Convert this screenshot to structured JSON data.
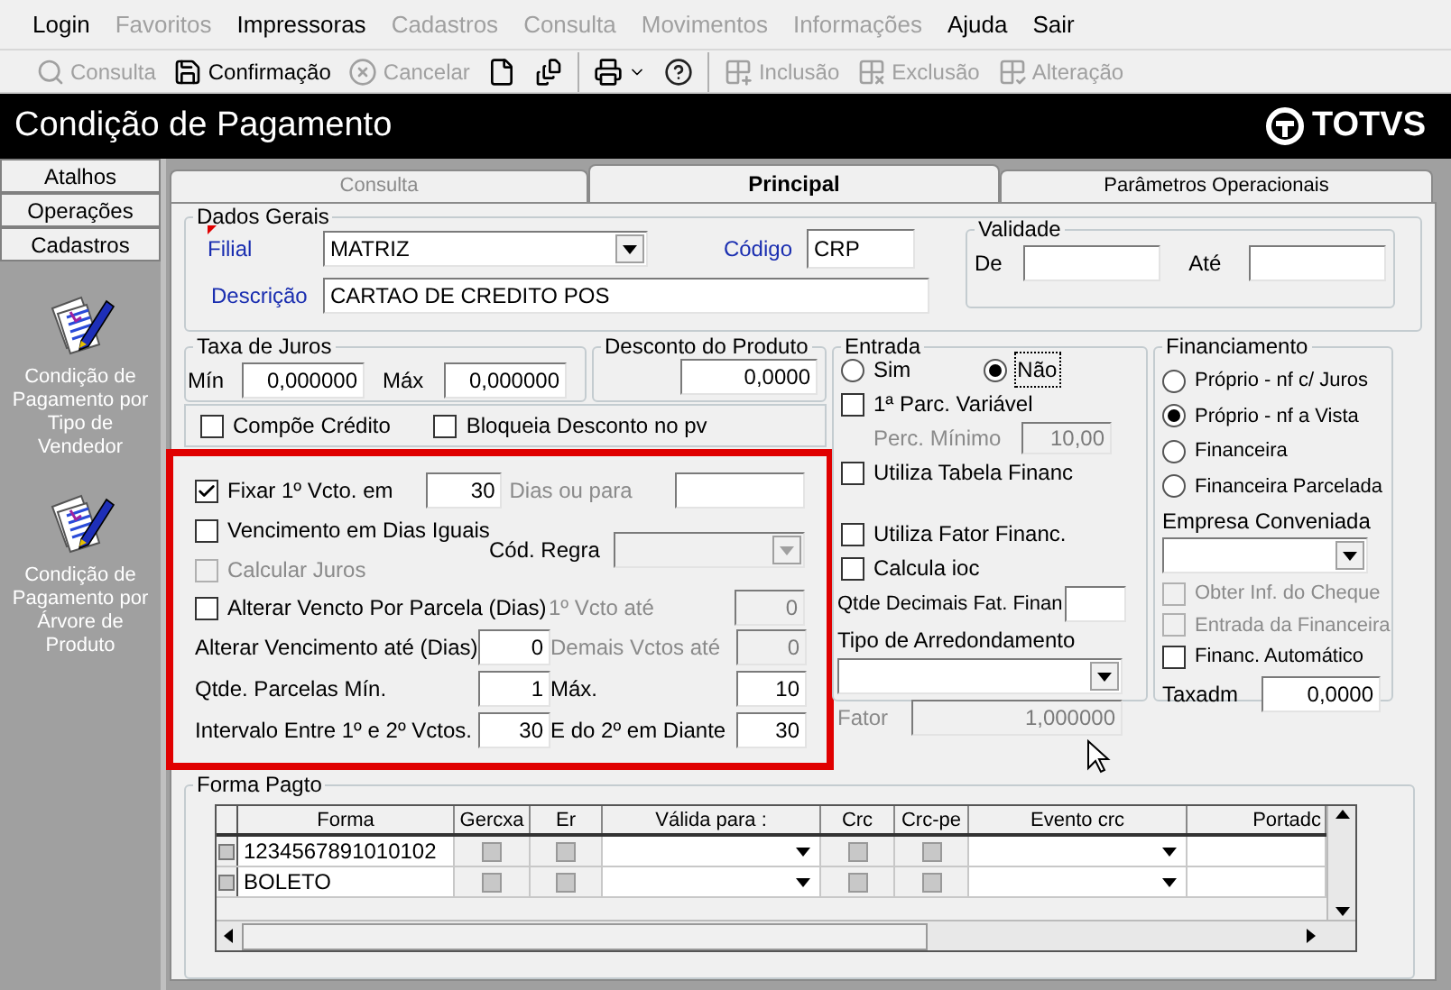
{
  "menu": [
    {
      "label": "Login",
      "disabled": false
    },
    {
      "label": "Favoritos",
      "disabled": true
    },
    {
      "label": "Impressoras",
      "disabled": false
    },
    {
      "label": "Cadastros",
      "disabled": true
    },
    {
      "label": "Consulta",
      "disabled": true
    },
    {
      "label": "Movimentos",
      "disabled": true
    },
    {
      "label": "Informações",
      "disabled": true
    },
    {
      "label": "Ajuda",
      "disabled": false
    },
    {
      "label": "Sair",
      "disabled": false
    }
  ],
  "toolbar": [
    {
      "items": [
        {
          "kind": "consult",
          "label": "Consulta",
          "disabled": true
        },
        {
          "kind": "save",
          "label": "Confirmação",
          "disabled": false
        },
        {
          "kind": "cancel",
          "label": "Cancelar",
          "disabled": true
        },
        {
          "kind": "new",
          "disabled": false
        },
        {
          "kind": "files",
          "disabled": false
        }
      ]
    },
    {
      "items": [
        {
          "kind": "print",
          "disabled": false,
          "dropdown": true
        },
        {
          "kind": "help",
          "disabled": false
        }
      ]
    },
    {
      "items": [
        {
          "kind": "add",
          "label": "Inclusão",
          "disabled": true
        },
        {
          "kind": "remove",
          "label": "Exclusão",
          "disabled": true
        },
        {
          "kind": "edit",
          "label": "Alteração",
          "disabled": true
        }
      ]
    }
  ],
  "header": {
    "title": "Condição de Pagamento",
    "logo": "TOTVS"
  },
  "sidebar": {
    "sections": [
      {
        "label": "Atalhos"
      },
      {
        "label": "Operações"
      },
      {
        "label": "Cadastros"
      }
    ],
    "items": [
      {
        "label": "Condição de Pagamento por Tipo de Vendedor"
      },
      {
        "label": "Condição de Pagamento por Árvore de Produto"
      }
    ]
  },
  "tabs": [
    {
      "label": "Consulta",
      "selected": false,
      "disabled": true
    },
    {
      "label": "Principal",
      "selected": true,
      "disabled": false
    },
    {
      "label": "Parâmetros Operacionais",
      "selected": false,
      "disabled": false
    }
  ],
  "dados_gerais": {
    "title": "Dados Gerais",
    "filial": {
      "label": "Filial",
      "required": true,
      "value": "MATRIZ"
    },
    "codigo": {
      "label": "Código",
      "value": "CRP"
    },
    "descricao": {
      "label": "Descrição",
      "value": "CARTAO DE CREDITO POS"
    },
    "validade": {
      "title": "Validade",
      "de": "De",
      "ate": "Até"
    }
  },
  "taxa_juros": {
    "title": "Taxa de Juros",
    "min_label": "Mín",
    "min": "0,000000",
    "max_label": "Máx",
    "max": "0,000000"
  },
  "desconto": {
    "title": "Desconto do Produto",
    "value": "0,0000"
  },
  "opcoes": [
    {
      "label": "Compõe Crédito",
      "checked": false
    },
    {
      "label": "Bloqueia Desconto no pv",
      "checked": false
    }
  ],
  "vencimento": {
    "highlighted": true,
    "checks": [
      {
        "label": "Fixar 1º Vcto. em",
        "checked": true,
        "disabled": false
      },
      {
        "label": "Vencimento em Dias Iguais",
        "checked": false,
        "disabled": false
      },
      {
        "label": "Calcular Juros",
        "checked": false,
        "disabled": true
      },
      {
        "label": "Alterar Vencto Por Parcela (Dias)",
        "checked": false,
        "disabled": false
      }
    ],
    "fixar_dias": "30",
    "dias_ou_para": {
      "label": "Dias ou para",
      "disabled": true
    },
    "cod_regra": {
      "label": "Cód. Regra",
      "disabled": true
    },
    "primeiro_vcto": {
      "label": "1º Vcto até",
      "value": "0",
      "disabled": true
    },
    "alterar": {
      "label": "Alterar Vencimento até (Dias)",
      "value": "0",
      "disabled": false
    },
    "demais": {
      "label": "Demais Vctos até",
      "value": "0",
      "disabled": true
    },
    "parcelas_min": {
      "label": "Qtde. Parcelas Mín.",
      "value": "1",
      "disabled": false
    },
    "parcelas_max": {
      "label": "Máx.",
      "value": "10",
      "disabled": false
    },
    "intervalo": {
      "label": "Intervalo Entre 1º e 2º Vctos.",
      "value": "30",
      "disabled": false
    },
    "diante": {
      "label": "E do 2º em Diante",
      "value": "30",
      "disabled": false
    }
  },
  "entrada": {
    "title": "Entrada",
    "radios": [
      {
        "label": "Sim",
        "selected": false
      },
      {
        "label": "Não",
        "selected": true
      }
    ],
    "parc_variavel": {
      "label": "1ª Parc. Variável",
      "checked": false
    },
    "perc_minimo": {
      "label": "Perc. Mínimo",
      "value": "10,00",
      "disabled": true
    },
    "tabela": {
      "label": "Utiliza Tabela Financ",
      "checked": false
    },
    "checks": [
      {
        "label": "Utiliza Fator Financ.",
        "checked": false
      },
      {
        "label": "Calcula ioc",
        "checked": false
      }
    ],
    "decimais": {
      "label": "Qtde Decimais Fat. Finan"
    },
    "arredondamento": {
      "label": "Tipo de Arredondamento"
    },
    "fator": {
      "label": "Fator",
      "value": "1,000000",
      "disabled": true
    }
  },
  "financiamento": {
    "title": "Financiamento",
    "radios": [
      {
        "label": "Próprio - nf c/ Juros",
        "selected": false
      },
      {
        "label": "Próprio - nf a Vista",
        "selected": true
      },
      {
        "label": "Financeira",
        "selected": false
      },
      {
        "label": "Financeira Parcelada",
        "selected": false
      }
    ],
    "empresa": {
      "label": "Empresa Conveniada"
    },
    "checks": [
      {
        "label": "Obter Inf. do Cheque",
        "checked": false,
        "disabled": true
      },
      {
        "label": "Entrada da Financeira",
        "checked": false,
        "disabled": true
      },
      {
        "label": "Financ. Automático",
        "checked": false,
        "disabled": false
      }
    ],
    "taxadm": {
      "label": "Taxadm",
      "value": "0,0000"
    }
  },
  "forma_pagto": {
    "title": "Forma Pagto",
    "columns": [
      {
        "label": "Forma",
        "kind": "text"
      },
      {
        "label": "Gercxa",
        "kind": "check"
      },
      {
        "label": "Er",
        "kind": "check"
      },
      {
        "label": "Válida para :",
        "kind": "combo"
      },
      {
        "label": "Crc",
        "kind": "check"
      },
      {
        "label": "Crc-pe",
        "kind": "check"
      },
      {
        "label": "Evento crc",
        "kind": "combo"
      },
      {
        "label": "Portadc",
        "kind": "text"
      }
    ],
    "rows": [
      {
        "forma": "1234567891010102",
        "checked": [
          false,
          false,
          false,
          false
        ]
      },
      {
        "forma": "BOLETO",
        "checked": [
          false,
          false,
          false,
          false
        ]
      }
    ]
  }
}
